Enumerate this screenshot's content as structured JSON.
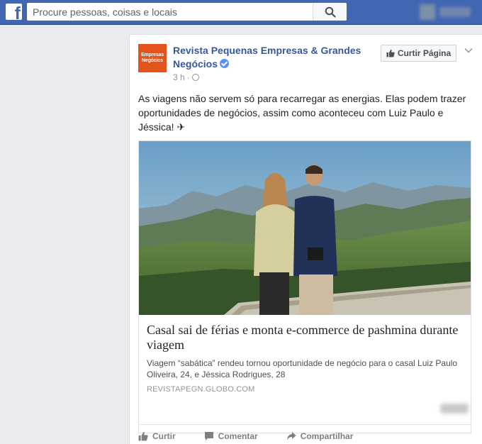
{
  "topbar": {
    "logo": "f",
    "search_placeholder": "Procure pessoas, coisas e locais"
  },
  "post": {
    "page_logo_line1": "Empresas",
    "page_logo_line2": "Negócios",
    "page_name": "Revista Pequenas Empresas & Grandes Negócios",
    "time": "3 h",
    "like_page_label": "Curtir Página",
    "text": "As viagens não servem só para recarregar as energias. Elas podem trazer oportunidades de negócios, assim como aconteceu com Luiz Paulo e Jéssica! ✈",
    "link": {
      "title": "Casal sai de férias e monta e-commerce de pashmina durante viagem",
      "description": "Viagem “sabática” rendeu tornou oportunidade de negócio para o casal Luiz Paulo Oliveira, 24, e Jéssica Rodrigues, 28",
      "domain": "REVISTAPEGN.GLOBO.COM"
    },
    "actions": {
      "like": "Curtir",
      "comment": "Comentar",
      "share": "Compartilhar"
    }
  },
  "colors": {
    "brand_blue": "#4267b2",
    "link_blue": "#365899",
    "page_logo_orange": "#e2541b"
  }
}
